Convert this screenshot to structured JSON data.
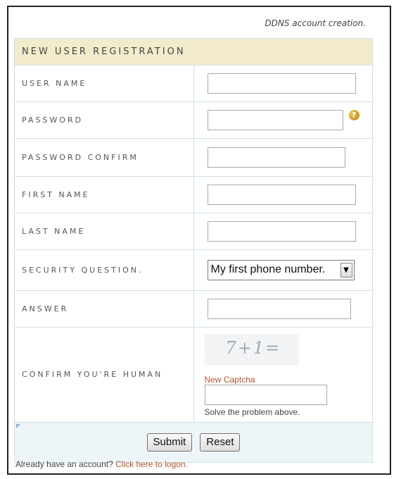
{
  "caption": "DDNS account creation.",
  "form": {
    "title": "NEW USER REGISTRATION",
    "fields": {
      "username": {
        "label": "USER NAME",
        "value": ""
      },
      "password": {
        "label": "PASSWORD",
        "value": "",
        "help_icon": "question-icon"
      },
      "password_confirm": {
        "label": "PASSWORD CONFIRM",
        "value": ""
      },
      "first_name": {
        "label": "FIRST NAME",
        "value": ""
      },
      "last_name": {
        "label": "LAST NAME",
        "value": ""
      },
      "security_question": {
        "label": "SECURITY QUESTION.",
        "selected": "My first phone number."
      },
      "answer": {
        "label": "ANSWER",
        "value": ""
      },
      "captcha": {
        "label": "CONFIRM YOU'RE HUMAN",
        "image_text": "7+1=",
        "new_link": "New Captcha",
        "value": "",
        "hint": "Solve the problem above."
      }
    },
    "buttons": {
      "submit": "Submit",
      "reset": "Reset"
    }
  },
  "footer": {
    "text": "Already have an account?",
    "link": "Click here to logon."
  },
  "colors": {
    "header_bg": "#f3eccc",
    "border": "#cfe0e8",
    "link": "#b5532b",
    "button_row_bg": "#eef5f8"
  }
}
